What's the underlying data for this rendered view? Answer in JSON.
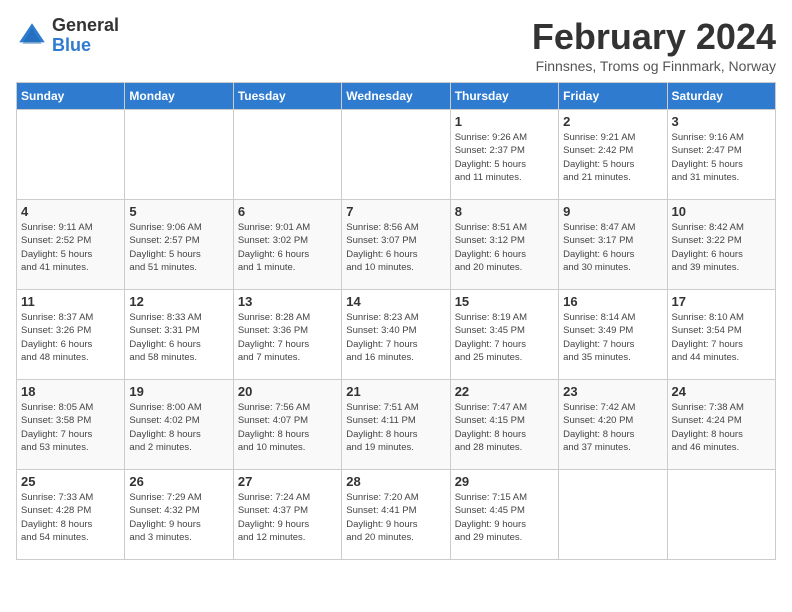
{
  "logo": {
    "general": "General",
    "blue": "Blue"
  },
  "title": "February 2024",
  "subtitle": "Finnsnes, Troms og Finnmark, Norway",
  "days_of_week": [
    "Sunday",
    "Monday",
    "Tuesday",
    "Wednesday",
    "Thursday",
    "Friday",
    "Saturday"
  ],
  "weeks": [
    [
      {
        "day": "",
        "info": ""
      },
      {
        "day": "",
        "info": ""
      },
      {
        "day": "",
        "info": ""
      },
      {
        "day": "",
        "info": ""
      },
      {
        "day": "1",
        "info": "Sunrise: 9:26 AM\nSunset: 2:37 PM\nDaylight: 5 hours\nand 11 minutes."
      },
      {
        "day": "2",
        "info": "Sunrise: 9:21 AM\nSunset: 2:42 PM\nDaylight: 5 hours\nand 21 minutes."
      },
      {
        "day": "3",
        "info": "Sunrise: 9:16 AM\nSunset: 2:47 PM\nDaylight: 5 hours\nand 31 minutes."
      }
    ],
    [
      {
        "day": "4",
        "info": "Sunrise: 9:11 AM\nSunset: 2:52 PM\nDaylight: 5 hours\nand 41 minutes."
      },
      {
        "day": "5",
        "info": "Sunrise: 9:06 AM\nSunset: 2:57 PM\nDaylight: 5 hours\nand 51 minutes."
      },
      {
        "day": "6",
        "info": "Sunrise: 9:01 AM\nSunset: 3:02 PM\nDaylight: 6 hours\nand 1 minute."
      },
      {
        "day": "7",
        "info": "Sunrise: 8:56 AM\nSunset: 3:07 PM\nDaylight: 6 hours\nand 10 minutes."
      },
      {
        "day": "8",
        "info": "Sunrise: 8:51 AM\nSunset: 3:12 PM\nDaylight: 6 hours\nand 20 minutes."
      },
      {
        "day": "9",
        "info": "Sunrise: 8:47 AM\nSunset: 3:17 PM\nDaylight: 6 hours\nand 30 minutes."
      },
      {
        "day": "10",
        "info": "Sunrise: 8:42 AM\nSunset: 3:22 PM\nDaylight: 6 hours\nand 39 minutes."
      }
    ],
    [
      {
        "day": "11",
        "info": "Sunrise: 8:37 AM\nSunset: 3:26 PM\nDaylight: 6 hours\nand 48 minutes."
      },
      {
        "day": "12",
        "info": "Sunrise: 8:33 AM\nSunset: 3:31 PM\nDaylight: 6 hours\nand 58 minutes."
      },
      {
        "day": "13",
        "info": "Sunrise: 8:28 AM\nSunset: 3:36 PM\nDaylight: 7 hours\nand 7 minutes."
      },
      {
        "day": "14",
        "info": "Sunrise: 8:23 AM\nSunset: 3:40 PM\nDaylight: 7 hours\nand 16 minutes."
      },
      {
        "day": "15",
        "info": "Sunrise: 8:19 AM\nSunset: 3:45 PM\nDaylight: 7 hours\nand 25 minutes."
      },
      {
        "day": "16",
        "info": "Sunrise: 8:14 AM\nSunset: 3:49 PM\nDaylight: 7 hours\nand 35 minutes."
      },
      {
        "day": "17",
        "info": "Sunrise: 8:10 AM\nSunset: 3:54 PM\nDaylight: 7 hours\nand 44 minutes."
      }
    ],
    [
      {
        "day": "18",
        "info": "Sunrise: 8:05 AM\nSunset: 3:58 PM\nDaylight: 7 hours\nand 53 minutes."
      },
      {
        "day": "19",
        "info": "Sunrise: 8:00 AM\nSunset: 4:02 PM\nDaylight: 8 hours\nand 2 minutes."
      },
      {
        "day": "20",
        "info": "Sunrise: 7:56 AM\nSunset: 4:07 PM\nDaylight: 8 hours\nand 10 minutes."
      },
      {
        "day": "21",
        "info": "Sunrise: 7:51 AM\nSunset: 4:11 PM\nDaylight: 8 hours\nand 19 minutes."
      },
      {
        "day": "22",
        "info": "Sunrise: 7:47 AM\nSunset: 4:15 PM\nDaylight: 8 hours\nand 28 minutes."
      },
      {
        "day": "23",
        "info": "Sunrise: 7:42 AM\nSunset: 4:20 PM\nDaylight: 8 hours\nand 37 minutes."
      },
      {
        "day": "24",
        "info": "Sunrise: 7:38 AM\nSunset: 4:24 PM\nDaylight: 8 hours\nand 46 minutes."
      }
    ],
    [
      {
        "day": "25",
        "info": "Sunrise: 7:33 AM\nSunset: 4:28 PM\nDaylight: 8 hours\nand 54 minutes."
      },
      {
        "day": "26",
        "info": "Sunrise: 7:29 AM\nSunset: 4:32 PM\nDaylight: 9 hours\nand 3 minutes."
      },
      {
        "day": "27",
        "info": "Sunrise: 7:24 AM\nSunset: 4:37 PM\nDaylight: 9 hours\nand 12 minutes."
      },
      {
        "day": "28",
        "info": "Sunrise: 7:20 AM\nSunset: 4:41 PM\nDaylight: 9 hours\nand 20 minutes."
      },
      {
        "day": "29",
        "info": "Sunrise: 7:15 AM\nSunset: 4:45 PM\nDaylight: 9 hours\nand 29 minutes."
      },
      {
        "day": "",
        "info": ""
      },
      {
        "day": "",
        "info": ""
      }
    ]
  ]
}
